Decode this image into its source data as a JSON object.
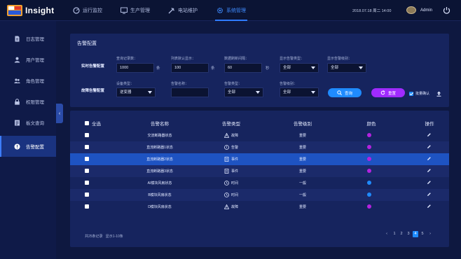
{
  "app": {
    "brand": "Insight"
  },
  "nav": [
    {
      "label": "运行监控",
      "icon": "dashboard-icon"
    },
    {
      "label": "生产管理",
      "icon": "monitor-icon"
    },
    {
      "label": "电站维护",
      "icon": "wrench-icon"
    },
    {
      "label": "系统管理",
      "icon": "gear-icon",
      "active": true
    }
  ],
  "header": {
    "date": "2018.07.18",
    "weekday": "周二",
    "time": "14:00",
    "user": "Admin"
  },
  "sidebar": {
    "items": [
      {
        "label": "日志管理",
        "icon": "document-icon"
      },
      {
        "label": "用户管理",
        "icon": "user-icon"
      },
      {
        "label": "角色管理",
        "icon": "users-icon"
      },
      {
        "label": "权限管理",
        "icon": "lock-icon"
      },
      {
        "label": "板文查询",
        "icon": "list-icon"
      },
      {
        "label": "告警配置",
        "icon": "alert-icon",
        "active": true
      }
    ]
  },
  "config": {
    "title": "告警配置",
    "realtime_label": "实时告警配置",
    "fault_label": "故障告警配置",
    "query_count_label": "查询记录数：",
    "query_count_value": "1000",
    "query_count_unit": "条",
    "default_show_label": "列表默认显示：",
    "default_show_value": "100",
    "default_show_unit": "条",
    "refresh_label": "数据刷新间隔：",
    "refresh_value": "60",
    "refresh_unit": "秒",
    "show_type_label": "显示告警类型：",
    "show_type_value": "全部",
    "show_level_label": "显示告警级别：",
    "show_level_value": "全部",
    "device_type_label": "设备类型：",
    "device_type_value": "逆变器",
    "alarm_name_label": "告警名称：",
    "alarm_name_value": "",
    "alarm_type_label": "告警类型：",
    "alarm_type_value": "全部",
    "alarm_level_label": "告警级别：",
    "alarm_level_value": "全部",
    "query_button": "查询",
    "reset_button": "重置",
    "batch_confirm": "批量确认"
  },
  "table": {
    "headers": [
      "全选",
      "告警名称",
      "告警类型",
      "告警级别",
      "颜色",
      "操作"
    ],
    "rows": [
      {
        "name": "交流断路器状态",
        "type": "故障",
        "type_icon": "warning-icon",
        "level": "重要",
        "color": "#b422e0"
      },
      {
        "name": "直流断路器1状态",
        "type": "告警",
        "type_icon": "clock-alert-icon",
        "level": "重要",
        "color": "#b422e0"
      },
      {
        "name": "直流断路器2状态",
        "type": "事件",
        "type_icon": "doc-event-icon",
        "level": "重要",
        "color": "#b422e0"
      },
      {
        "name": "直流断路器3状态",
        "type": "事件",
        "type_icon": "doc-event-icon",
        "level": "重要",
        "color": "#b422e0"
      },
      {
        "name": "AI模块风扇状态",
        "type": "时间",
        "type_icon": "clock-icon",
        "level": "一般",
        "color": "#1f8bff"
      },
      {
        "name": "B模块风扇状态",
        "type": "时间",
        "type_icon": "clock-icon",
        "level": "一般",
        "color": "#1f8bff"
      },
      {
        "name": "D模块风扇状态",
        "type": "故障",
        "type_icon": "warning-icon",
        "level": "重要",
        "color": "#b422e0"
      }
    ],
    "total_text": "共25条记录",
    "display_text": "显示1-10条"
  },
  "pager": {
    "pages": [
      "1",
      "2",
      "3",
      "4",
      "5"
    ],
    "current": "4"
  }
}
